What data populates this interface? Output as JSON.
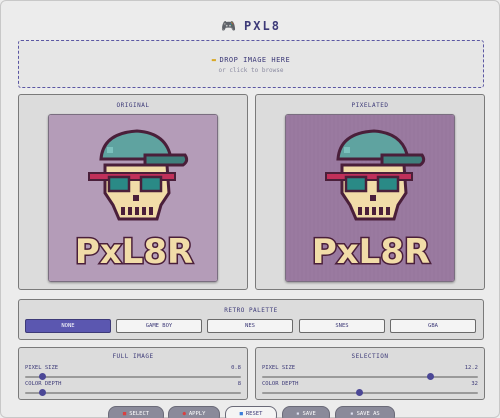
{
  "app": {
    "title": "PXL8",
    "icon": "gamepad-icon"
  },
  "dropzone": {
    "title": "DROP IMAGE HERE",
    "subtitle": "or click to browse",
    "icon": "folder-icon"
  },
  "panels": {
    "original": {
      "label": "ORIGINAL",
      "art_text": "PxL8R",
      "bg": "#b49cb8"
    },
    "pixelated": {
      "label": "PIXELATED",
      "art_text": "PxL8R",
      "bg": "#9a7aa0"
    }
  },
  "palette": {
    "label": "RETRO PALETTE",
    "options": [
      "NONE",
      "GAME BOY",
      "NES",
      "SNES",
      "GBA"
    ],
    "selected": "NONE"
  },
  "full_image": {
    "title": "FULL IMAGE",
    "pixel_size": {
      "label": "PIXEL SIZE",
      "value": "0.8",
      "fraction": 0.08
    },
    "color_depth": {
      "label": "COLOR DEPTH",
      "value": "8",
      "fraction": 0.08
    }
  },
  "selection": {
    "title": "SELECTION",
    "pixel_size": {
      "label": "PIXEL SIZE",
      "value": "12.2",
      "fraction": 0.78
    },
    "color_depth": {
      "label": "COLOR DEPTH",
      "value": "32",
      "fraction": 0.45
    }
  },
  "actions": [
    {
      "label": "SELECT",
      "icon": "select-icon",
      "style": "dark"
    },
    {
      "label": "APPLY",
      "icon": "apply-icon",
      "style": "dark"
    },
    {
      "label": "RESET",
      "icon": "reset-icon",
      "style": "light"
    },
    {
      "label": "SAVE",
      "icon": "save-icon",
      "style": "dark"
    },
    {
      "label": "SAVE AS",
      "icon": "save-as-icon",
      "style": "dark"
    }
  ],
  "colors": {
    "accent": "#5b57b0",
    "text": "#3d3a78",
    "cap": "#5fa3a0",
    "brim": "#3f7f7c",
    "skull": "#f1dca8",
    "glasses": "#c0305a",
    "outline": "#4a1f3a"
  }
}
